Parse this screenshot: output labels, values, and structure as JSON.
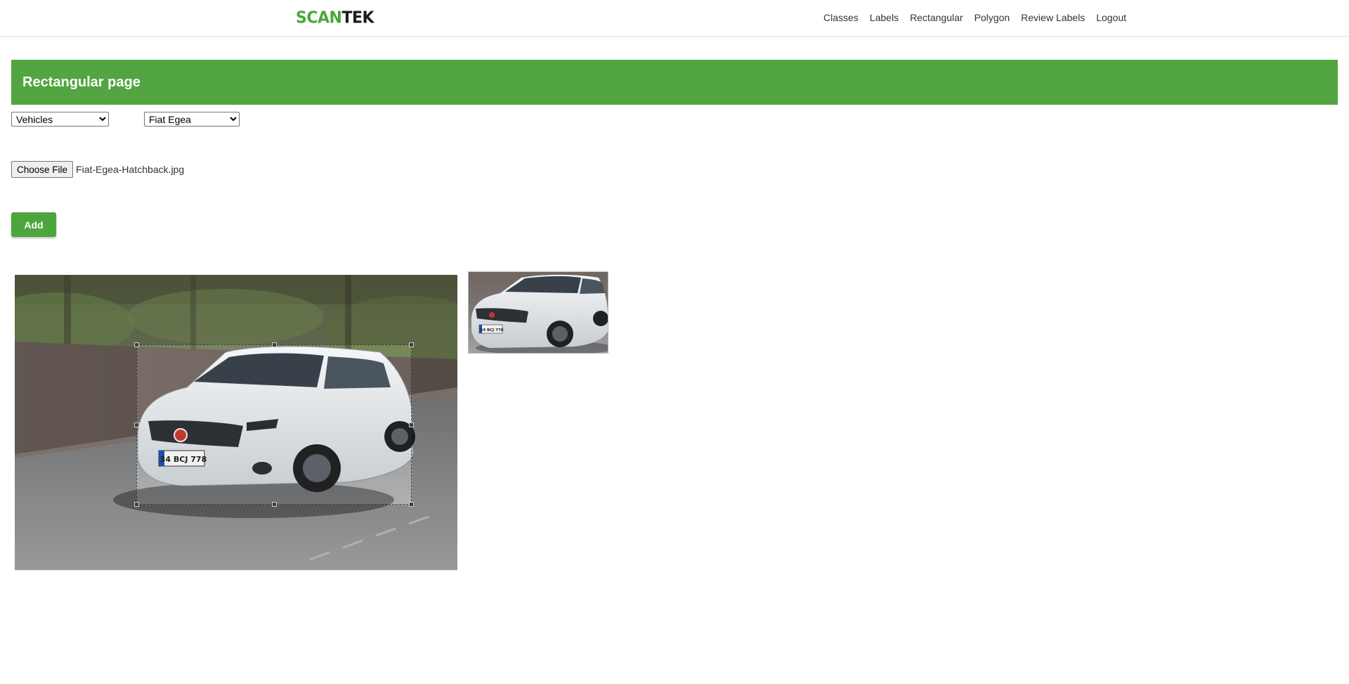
{
  "brand": {
    "part1": "SCAN",
    "part2": "TEK",
    "accent_color": "#4ca63d",
    "dark_color": "#1c1c1c"
  },
  "nav": {
    "items": [
      {
        "label": "Classes"
      },
      {
        "label": "Labels"
      },
      {
        "label": "Rectangular"
      },
      {
        "label": "Polygon"
      },
      {
        "label": "Review Labels"
      },
      {
        "label": "Logout"
      }
    ]
  },
  "banner": {
    "title": "Rectangular page",
    "color": "#52a541"
  },
  "form": {
    "class_select": {
      "selected": "Vehicles"
    },
    "label_select": {
      "selected": "Fiat Egea"
    },
    "file": {
      "button_label": "Choose File",
      "file_name": "Fiat-Egea-Hatchback.jpg"
    },
    "add_label": "Add"
  },
  "annotation": {
    "image_subject": "white hatchback car on road",
    "license_plate": "34 BCJ 778",
    "thumb_plate": "34 BCJ 778"
  }
}
